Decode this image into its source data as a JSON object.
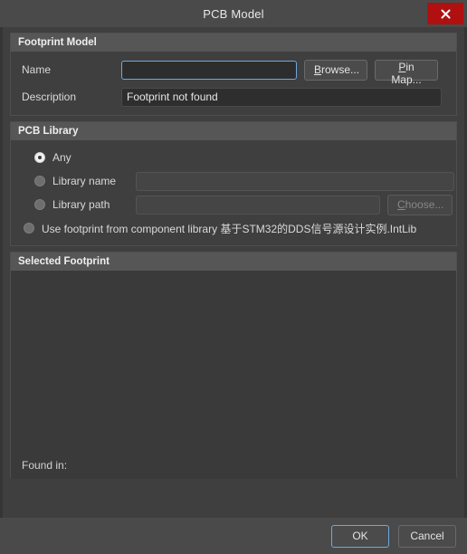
{
  "window": {
    "title": "PCB Model",
    "close_icon": "close-icon",
    "accent_focus_color": "#6fa8dc",
    "close_button_color": "#b01010",
    "background_color": "#3f3f3f",
    "header_bar_color": "#565656"
  },
  "footprint_model": {
    "group_title": "Footprint Model",
    "name_label": "Name",
    "name_value": "",
    "name_placeholder": "",
    "browse_label": "Browse...",
    "browse_accelerator": "B",
    "pin_map_label": "Pin Map...",
    "pin_map_accelerator": "P",
    "description_label": "Description",
    "description_value": "Footprint not found"
  },
  "pcb_library": {
    "group_title": "PCB Library",
    "options": [
      {
        "label": "Any",
        "selected": true,
        "has_input": false
      },
      {
        "label": "Library name",
        "selected": false,
        "has_input": true,
        "input_value": ""
      },
      {
        "label": "Library path",
        "selected": false,
        "has_input": true,
        "input_value": ""
      }
    ],
    "choose_label": "Choose...",
    "choose_accelerator": "C",
    "choose_disabled": true,
    "component_library_option": {
      "label": "Use footprint from component library",
      "library_name": "基于STM32的DDS信号源设计实例.IntLib",
      "selected": false
    }
  },
  "selected_footprint": {
    "group_title": "Selected Footprint",
    "preview_content": "",
    "found_in_label": "Found in:",
    "found_in_value": ""
  },
  "footer": {
    "ok_label": "OK",
    "cancel_label": "Cancel"
  }
}
